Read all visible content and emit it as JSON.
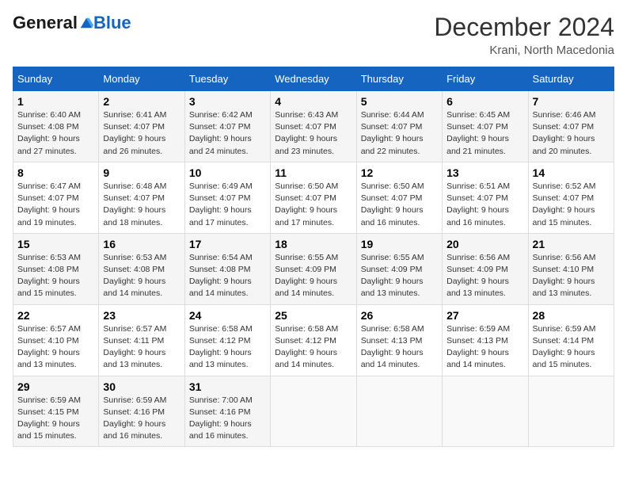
{
  "logo": {
    "general": "General",
    "blue": "Blue"
  },
  "title": "December 2024",
  "location": "Krani, North Macedonia",
  "days_of_week": [
    "Sunday",
    "Monday",
    "Tuesday",
    "Wednesday",
    "Thursday",
    "Friday",
    "Saturday"
  ],
  "weeks": [
    [
      {
        "day": "1",
        "sunrise": "Sunrise: 6:40 AM",
        "sunset": "Sunset: 4:08 PM",
        "daylight": "Daylight: 9 hours and 27 minutes."
      },
      {
        "day": "2",
        "sunrise": "Sunrise: 6:41 AM",
        "sunset": "Sunset: 4:07 PM",
        "daylight": "Daylight: 9 hours and 26 minutes."
      },
      {
        "day": "3",
        "sunrise": "Sunrise: 6:42 AM",
        "sunset": "Sunset: 4:07 PM",
        "daylight": "Daylight: 9 hours and 24 minutes."
      },
      {
        "day": "4",
        "sunrise": "Sunrise: 6:43 AM",
        "sunset": "Sunset: 4:07 PM",
        "daylight": "Daylight: 9 hours and 23 minutes."
      },
      {
        "day": "5",
        "sunrise": "Sunrise: 6:44 AM",
        "sunset": "Sunset: 4:07 PM",
        "daylight": "Daylight: 9 hours and 22 minutes."
      },
      {
        "day": "6",
        "sunrise": "Sunrise: 6:45 AM",
        "sunset": "Sunset: 4:07 PM",
        "daylight": "Daylight: 9 hours and 21 minutes."
      },
      {
        "day": "7",
        "sunrise": "Sunrise: 6:46 AM",
        "sunset": "Sunset: 4:07 PM",
        "daylight": "Daylight: 9 hours and 20 minutes."
      }
    ],
    [
      {
        "day": "8",
        "sunrise": "Sunrise: 6:47 AM",
        "sunset": "Sunset: 4:07 PM",
        "daylight": "Daylight: 9 hours and 19 minutes."
      },
      {
        "day": "9",
        "sunrise": "Sunrise: 6:48 AM",
        "sunset": "Sunset: 4:07 PM",
        "daylight": "Daylight: 9 hours and 18 minutes."
      },
      {
        "day": "10",
        "sunrise": "Sunrise: 6:49 AM",
        "sunset": "Sunset: 4:07 PM",
        "daylight": "Daylight: 9 hours and 17 minutes."
      },
      {
        "day": "11",
        "sunrise": "Sunrise: 6:50 AM",
        "sunset": "Sunset: 4:07 PM",
        "daylight": "Daylight: 9 hours and 17 minutes."
      },
      {
        "day": "12",
        "sunrise": "Sunrise: 6:50 AM",
        "sunset": "Sunset: 4:07 PM",
        "daylight": "Daylight: 9 hours and 16 minutes."
      },
      {
        "day": "13",
        "sunrise": "Sunrise: 6:51 AM",
        "sunset": "Sunset: 4:07 PM",
        "daylight": "Daylight: 9 hours and 16 minutes."
      },
      {
        "day": "14",
        "sunrise": "Sunrise: 6:52 AM",
        "sunset": "Sunset: 4:07 PM",
        "daylight": "Daylight: 9 hours and 15 minutes."
      }
    ],
    [
      {
        "day": "15",
        "sunrise": "Sunrise: 6:53 AM",
        "sunset": "Sunset: 4:08 PM",
        "daylight": "Daylight: 9 hours and 15 minutes."
      },
      {
        "day": "16",
        "sunrise": "Sunrise: 6:53 AM",
        "sunset": "Sunset: 4:08 PM",
        "daylight": "Daylight: 9 hours and 14 minutes."
      },
      {
        "day": "17",
        "sunrise": "Sunrise: 6:54 AM",
        "sunset": "Sunset: 4:08 PM",
        "daylight": "Daylight: 9 hours and 14 minutes."
      },
      {
        "day": "18",
        "sunrise": "Sunrise: 6:55 AM",
        "sunset": "Sunset: 4:09 PM",
        "daylight": "Daylight: 9 hours and 14 minutes."
      },
      {
        "day": "19",
        "sunrise": "Sunrise: 6:55 AM",
        "sunset": "Sunset: 4:09 PM",
        "daylight": "Daylight: 9 hours and 13 minutes."
      },
      {
        "day": "20",
        "sunrise": "Sunrise: 6:56 AM",
        "sunset": "Sunset: 4:09 PM",
        "daylight": "Daylight: 9 hours and 13 minutes."
      },
      {
        "day": "21",
        "sunrise": "Sunrise: 6:56 AM",
        "sunset": "Sunset: 4:10 PM",
        "daylight": "Daylight: 9 hours and 13 minutes."
      }
    ],
    [
      {
        "day": "22",
        "sunrise": "Sunrise: 6:57 AM",
        "sunset": "Sunset: 4:10 PM",
        "daylight": "Daylight: 9 hours and 13 minutes."
      },
      {
        "day": "23",
        "sunrise": "Sunrise: 6:57 AM",
        "sunset": "Sunset: 4:11 PM",
        "daylight": "Daylight: 9 hours and 13 minutes."
      },
      {
        "day": "24",
        "sunrise": "Sunrise: 6:58 AM",
        "sunset": "Sunset: 4:12 PM",
        "daylight": "Daylight: 9 hours and 13 minutes."
      },
      {
        "day": "25",
        "sunrise": "Sunrise: 6:58 AM",
        "sunset": "Sunset: 4:12 PM",
        "daylight": "Daylight: 9 hours and 14 minutes."
      },
      {
        "day": "26",
        "sunrise": "Sunrise: 6:58 AM",
        "sunset": "Sunset: 4:13 PM",
        "daylight": "Daylight: 9 hours and 14 minutes."
      },
      {
        "day": "27",
        "sunrise": "Sunrise: 6:59 AM",
        "sunset": "Sunset: 4:13 PM",
        "daylight": "Daylight: 9 hours and 14 minutes."
      },
      {
        "day": "28",
        "sunrise": "Sunrise: 6:59 AM",
        "sunset": "Sunset: 4:14 PM",
        "daylight": "Daylight: 9 hours and 15 minutes."
      }
    ],
    [
      {
        "day": "29",
        "sunrise": "Sunrise: 6:59 AM",
        "sunset": "Sunset: 4:15 PM",
        "daylight": "Daylight: 9 hours and 15 minutes."
      },
      {
        "day": "30",
        "sunrise": "Sunrise: 6:59 AM",
        "sunset": "Sunset: 4:16 PM",
        "daylight": "Daylight: 9 hours and 16 minutes."
      },
      {
        "day": "31",
        "sunrise": "Sunrise: 7:00 AM",
        "sunset": "Sunset: 4:16 PM",
        "daylight": "Daylight: 9 hours and 16 minutes."
      },
      null,
      null,
      null,
      null
    ]
  ]
}
